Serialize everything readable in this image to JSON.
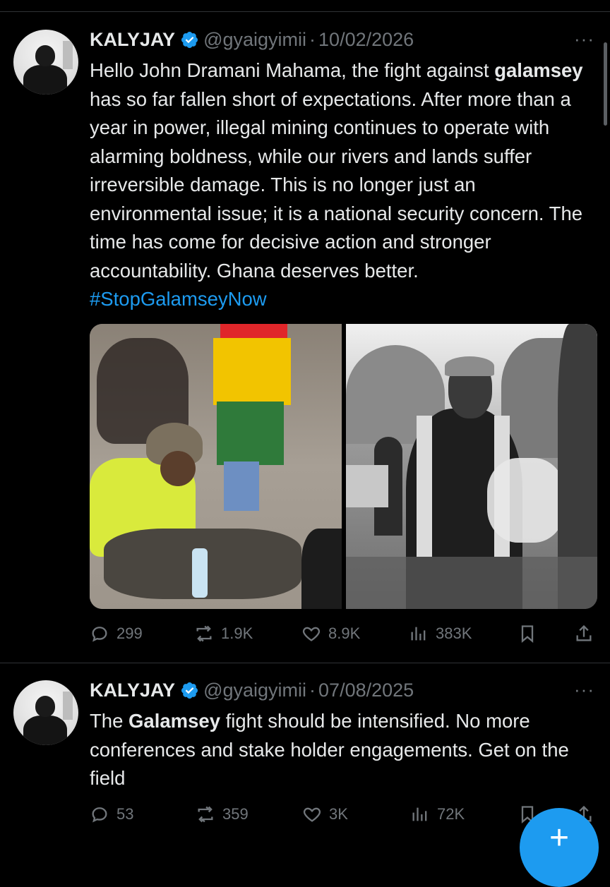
{
  "tweets": [
    {
      "author_name": "KALYJAY",
      "handle": "@gyaigyimii",
      "separator": "·",
      "date": "10/02/2026",
      "more_label": "···",
      "text_parts": {
        "p1": "Hello John Dramani Mahama, the fight against ",
        "bold": "galamsey",
        "p2": " has so far fallen short of expectations. After more than a year in power, illegal mining continues to operate with alarming boldness, while our rivers and lands suffer irreversible damage. This is no longer just an environmental issue; it is a national security concern. The time has come for decisive action and stronger accountability. Ghana deserves better. ",
        "hashtag": "#StopGalamseyNow"
      },
      "media": [
        "left-photo",
        "right-photo"
      ],
      "stats": {
        "replies": "299",
        "reposts": "1.9K",
        "likes": "8.9K",
        "views": "383K"
      }
    },
    {
      "author_name": "KALYJAY",
      "handle": "@gyaigyimii",
      "separator": "·",
      "date": "07/08/2025",
      "more_label": "···",
      "text_parts": {
        "p1": "The ",
        "bold": "Galamsey",
        "p2": " fight should be intensified. No more conferences and stake holder engagements. Get on the field"
      },
      "stats": {
        "replies": "53",
        "reposts": "359",
        "likes": "3K",
        "views": "72K"
      }
    }
  ],
  "icons": {
    "verified": "verified-badge-icon",
    "reply": "reply-icon",
    "repost": "repost-icon",
    "like": "heart-icon",
    "views": "views-icon",
    "bookmark": "bookmark-icon",
    "share": "share-icon",
    "compose": "compose-plus-icon"
  },
  "compose_label": "+",
  "colors": {
    "background": "#000000",
    "text": "#e7e9ea",
    "muted": "#71767b",
    "accent": "#1d9bf0",
    "divider": "#2f3336"
  }
}
